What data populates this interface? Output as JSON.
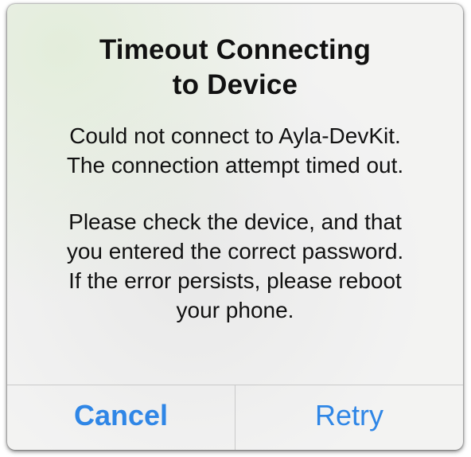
{
  "alert": {
    "title_lines": [
      "Timeout Connecting",
      "to Device"
    ],
    "message_lines": [
      "Could not connect to Ayla-DevKit.",
      "The connection attempt timed out.",
      "",
      "Please check the device, and that",
      "you entered the correct password.",
      "If the error persists, please reboot",
      "your phone."
    ],
    "buttons": {
      "cancel_label": "Cancel",
      "retry_label": "Retry"
    }
  },
  "colors": {
    "button_text": "#2f86e6",
    "title_text": "#111111",
    "divider": "#c9c9c9"
  }
}
